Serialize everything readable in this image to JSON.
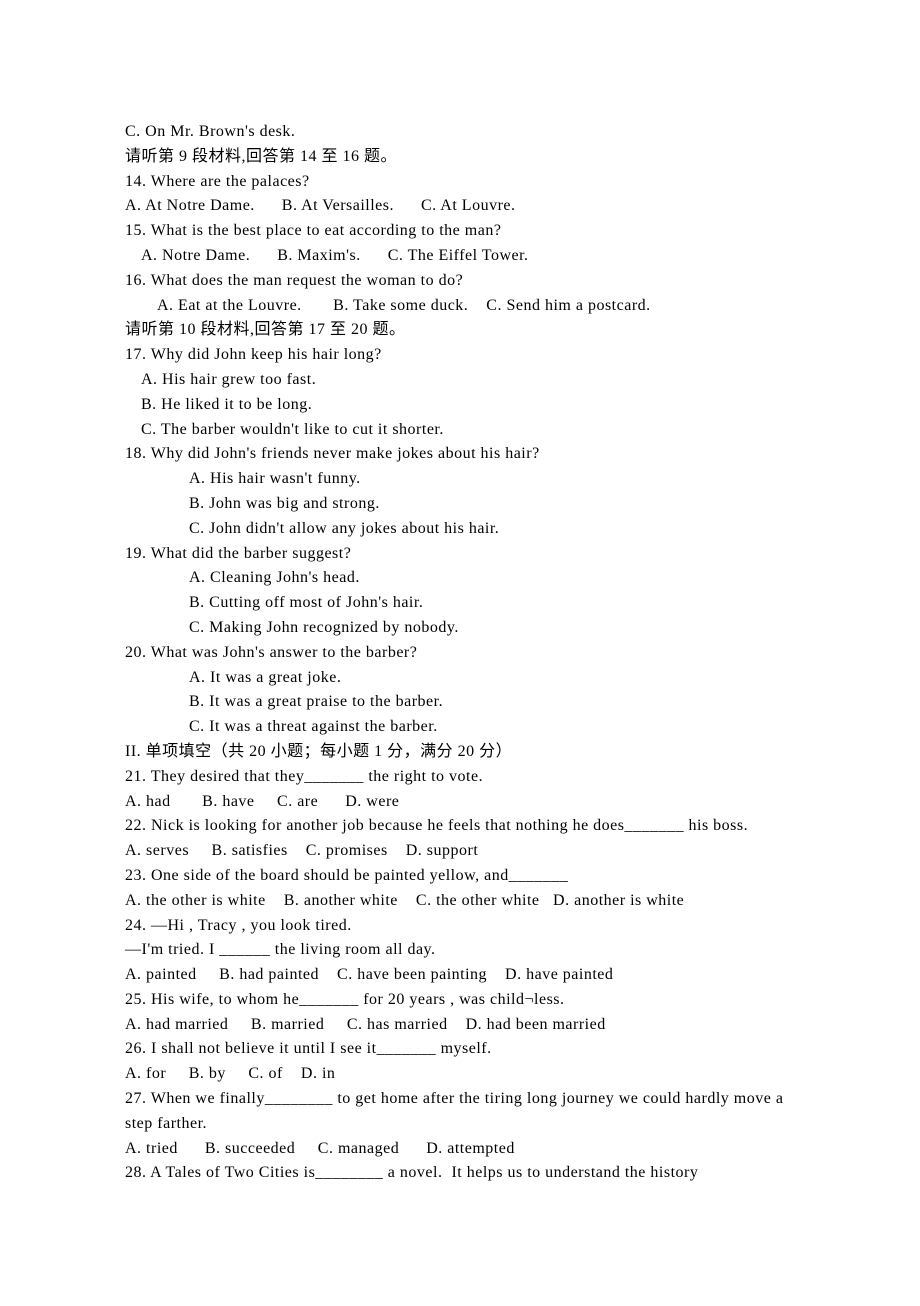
{
  "lines": [
    {
      "text": "C. On Mr. Brown's desk.",
      "indent": ""
    },
    {
      "text": "请听第 9 段材料,回答第 14 至 16 题。",
      "indent": ""
    },
    {
      "text": "14. Where are the palaces?",
      "indent": ""
    },
    {
      "text": "A. At Notre Dame.      B. At Versailles.      C. At Louvre.",
      "indent": ""
    },
    {
      "text": "15. What is the best place to eat according to the man?",
      "indent": ""
    },
    {
      "text": "A. Notre Dame.      B. Maxim's.      C. The Eiffel Tower.",
      "indent": "indent-1"
    },
    {
      "text": "16. What does the man request the woman to do?",
      "indent": ""
    },
    {
      "text": "A. Eat at the Louvre.       B. Take some duck.    C. Send him a postcard.",
      "indent": "indent-2"
    },
    {
      "text": "请听第 10 段材料,回答第 17 至 20 题。",
      "indent": ""
    },
    {
      "text": "17. Why did John keep his hair long?",
      "indent": ""
    },
    {
      "text": "A. His hair grew too fast.",
      "indent": "indent-1"
    },
    {
      "text": "B. He liked it to be long.",
      "indent": "indent-1"
    },
    {
      "text": "C. The barber wouldn't like to cut it shorter.",
      "indent": "indent-1"
    },
    {
      "text": "18. Why did John's friends never make jokes about his hair?",
      "indent": ""
    },
    {
      "text": "A. His hair wasn't funny.",
      "indent": "indent-4"
    },
    {
      "text": "B. John was big and strong.",
      "indent": "indent-4"
    },
    {
      "text": "C. John didn't allow any jokes about his hair.",
      "indent": "indent-4"
    },
    {
      "text": "19. What did the barber suggest?",
      "indent": ""
    },
    {
      "text": "A. Cleaning John's head.",
      "indent": "indent-4"
    },
    {
      "text": "B. Cutting off most of John's hair.",
      "indent": "indent-4"
    },
    {
      "text": "C. Making John recognized by nobody.",
      "indent": "indent-4"
    },
    {
      "text": "20. What was John's answer to the barber?",
      "indent": ""
    },
    {
      "text": "A. It was a great joke.",
      "indent": "indent-4"
    },
    {
      "text": "B. It was a great praise to the barber.",
      "indent": "indent-4"
    },
    {
      "text": "C. It was a threat against the barber.",
      "indent": "indent-4"
    },
    {
      "text": "II. 单项填空（共 20 小题；每小题 1 分，满分 20 分）",
      "indent": ""
    },
    {
      "text": "21. They desired that they_______ the right to vote.",
      "indent": ""
    },
    {
      "text": "A. had       B. have     C. are      D. were",
      "indent": ""
    },
    {
      "text": "22. Nick is looking for another job because he feels that nothing he does_______ his boss.",
      "indent": ""
    },
    {
      "text": "A. serves     B. satisfies    C. promises    D. support",
      "indent": ""
    },
    {
      "text": "23. One side of the board should be painted yellow, and_______",
      "indent": ""
    },
    {
      "text": "A. the other is white    B. another white    C. the other white   D. another is white",
      "indent": ""
    },
    {
      "text": "24. —Hi , Tracy , you look tired.",
      "indent": ""
    },
    {
      "text": "—I'm tried. I ______ the living room all day.",
      "indent": ""
    },
    {
      "text": "A. painted     B. had painted    C. have been painting    D. have painted",
      "indent": ""
    },
    {
      "text": "25. His wife, to whom he_______ for 20 years , was child¬less.",
      "indent": ""
    },
    {
      "text": "A. had married     B. married     C. has married    D. had been married",
      "indent": ""
    },
    {
      "text": "26. I shall not believe it until I see it_______ myself.",
      "indent": ""
    },
    {
      "text": "A. for     B. by     C. of    D. in",
      "indent": ""
    },
    {
      "text": "27. When we finally________ to get home after the tiring long journey we could hardly move a step farther.",
      "indent": ""
    },
    {
      "text": "A. tried      B. succeeded     C. managed      D. attempted",
      "indent": ""
    },
    {
      "text": "28. A Tales of Two Cities is________ a novel.  It helps us to understand the history",
      "indent": ""
    }
  ]
}
